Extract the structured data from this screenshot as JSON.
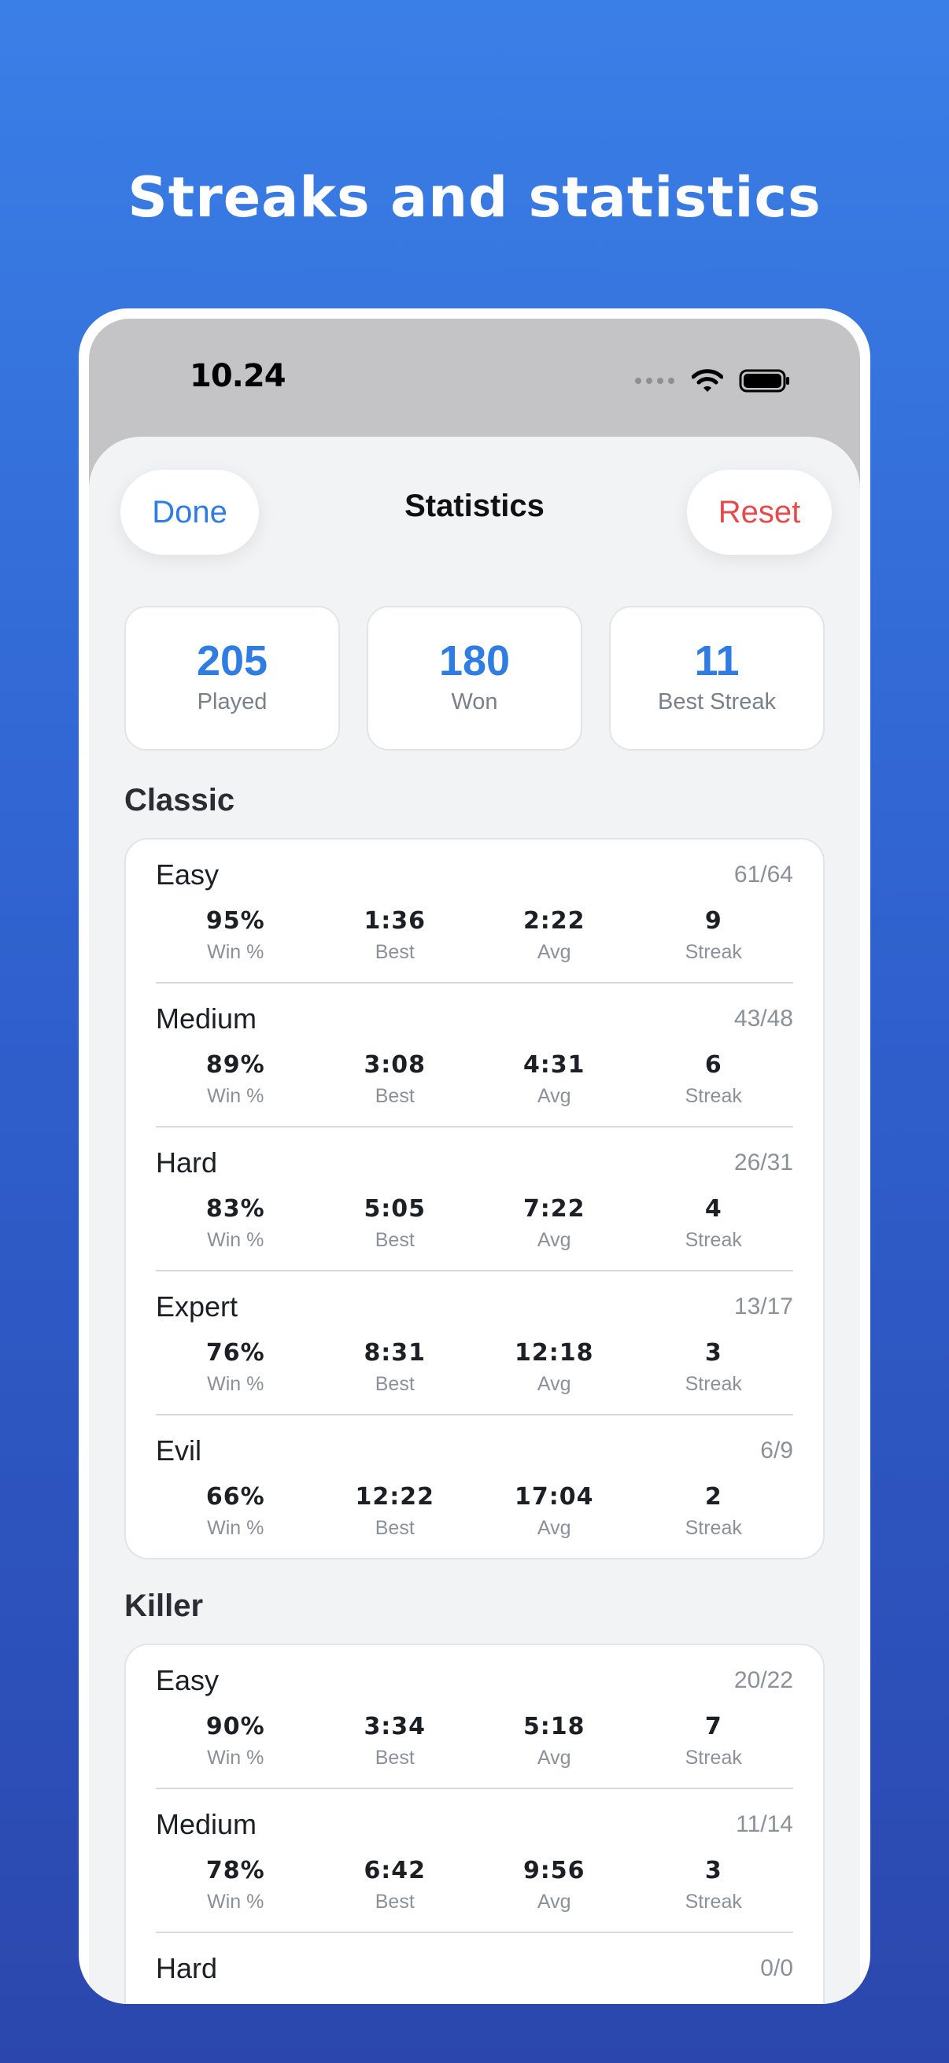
{
  "headline": "Streaks and statistics",
  "status": {
    "time": "10.24"
  },
  "nav": {
    "done": "Done",
    "title": "Statistics",
    "reset": "Reset"
  },
  "summary": [
    {
      "value": "205",
      "label": "Played"
    },
    {
      "value": "180",
      "label": "Won"
    },
    {
      "value": "11",
      "label": "Best Streak"
    }
  ],
  "stat_labels": {
    "win": "Win %",
    "best": "Best",
    "avg": "Avg",
    "streak": "Streak"
  },
  "sections": [
    {
      "title": "Classic",
      "rows": [
        {
          "name": "Easy",
          "ratio": "61/64",
          "win": "95%",
          "best": "1:36",
          "avg": "2:22",
          "streak": "9"
        },
        {
          "name": "Medium",
          "ratio": "43/48",
          "win": "89%",
          "best": "3:08",
          "avg": "4:31",
          "streak": "6"
        },
        {
          "name": "Hard",
          "ratio": "26/31",
          "win": "83%",
          "best": "5:05",
          "avg": "7:22",
          "streak": "4"
        },
        {
          "name": "Expert",
          "ratio": "13/17",
          "win": "76%",
          "best": "8:31",
          "avg": "12:18",
          "streak": "3"
        },
        {
          "name": "Evil",
          "ratio": "6/9",
          "win": "66%",
          "best": "12:22",
          "avg": "17:04",
          "streak": "2"
        }
      ]
    },
    {
      "title": "Killer",
      "rows": [
        {
          "name": "Easy",
          "ratio": "20/22",
          "win": "90%",
          "best": "3:34",
          "avg": "5:18",
          "streak": "7"
        },
        {
          "name": "Medium",
          "ratio": "11/14",
          "win": "78%",
          "best": "6:42",
          "avg": "9:56",
          "streak": "3"
        },
        {
          "name": "Hard",
          "ratio": "0/0"
        }
      ]
    }
  ],
  "colors": {
    "accent": "#2f7de3",
    "destructive": "#e54b4b",
    "background_top": "#3a7fe7",
    "background_bottom": "#2b47ad"
  }
}
